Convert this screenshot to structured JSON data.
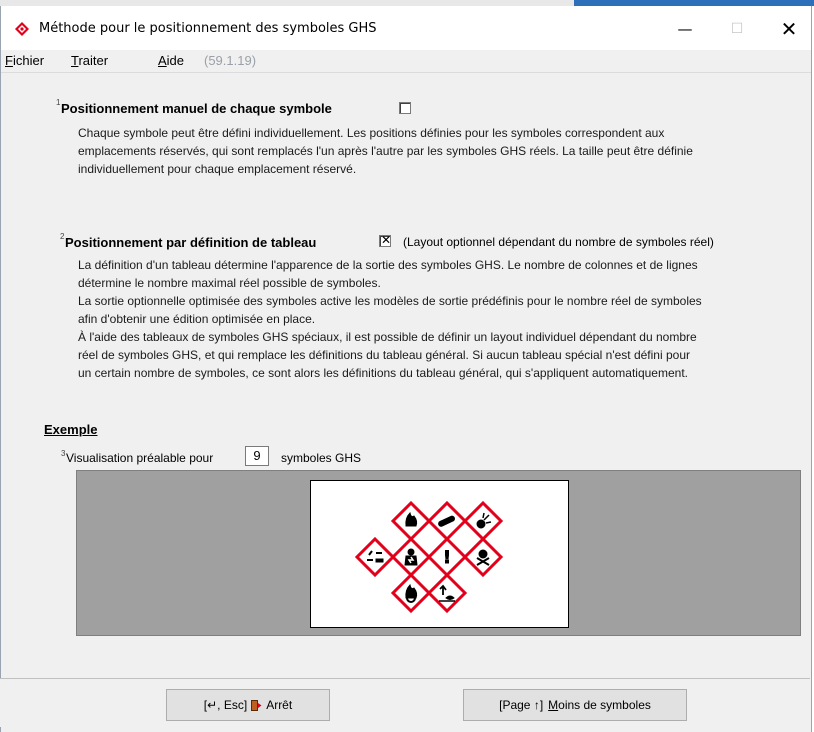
{
  "window": {
    "title": "Méthode pour le positionnement des symboles GHS",
    "controls": {
      "minimize": "—",
      "maximize": "☐",
      "close": "✕"
    }
  },
  "menu": {
    "items": [
      "Fichier",
      "Traiter",
      "Aide"
    ],
    "version": "(59.1.19)"
  },
  "section1": {
    "number": "1",
    "title": "Positionnement manuel de chaque symbole",
    "checked": false,
    "lines": [
      "Chaque symbole peut être défini individuellement. Les positions définies pour les symboles correspondent aux",
      "emplacements réservés, qui sont remplacés l'un après l'autre par les symboles GHS réels. La taille peut être définie",
      "individuellement pour chaque emplacement réservé."
    ]
  },
  "section2": {
    "number": "2",
    "title": "Positionnement par définition de tableau",
    "checked": true,
    "checkbox_note": "(Layout optionnel dépendant du nombre de symboles réel)",
    "lines": [
      "La définition d'un tableau détermine l'apparence de la sortie des symboles GHS. Le nombre de colonnes et de lignes",
      "détermine le nombre maximal réel possible de symboles.",
      "La sortie optionnelle optimisée des symboles active les modèles de sortie prédéfinis pour le nombre réel de symboles",
      "afin d'obtenir une édition optimisée en place.",
      "À l'aide des tableaux de symboles GHS spéciaux, il est possible de définir un layout individuel dépendant du nombre",
      "réel de symboles GHS, et qui remplace les définitions du tableau général. Si aucun tableau spécial n'est défini pour",
      "un certain nombre de symboles, ce sont alors les définitions du tableau général, qui s'appliquent automatiquement."
    ]
  },
  "example": {
    "heading": "Exemple",
    "number": "3",
    "preview_label": "Visualisation préalable pour",
    "symbol_count": "9",
    "preview_suffix": "symboles GHS",
    "symbols": [
      "flame",
      "gas-cylinder",
      "exploding-bomb",
      "health-hazard",
      "corrosion",
      "exclamation-mark",
      "flame-over-circle",
      "skull-crossbones",
      "environment"
    ]
  },
  "buttons": {
    "stop": {
      "prefix": "[↵, Esc]",
      "label": "Arrêt"
    },
    "fewer": {
      "prefix": "[Page ↑]",
      "accel": "M",
      "rest": "oins de symboles"
    }
  },
  "colors": {
    "ghs_red": "#e2001a",
    "preview_bg": "#a0a0a0"
  }
}
